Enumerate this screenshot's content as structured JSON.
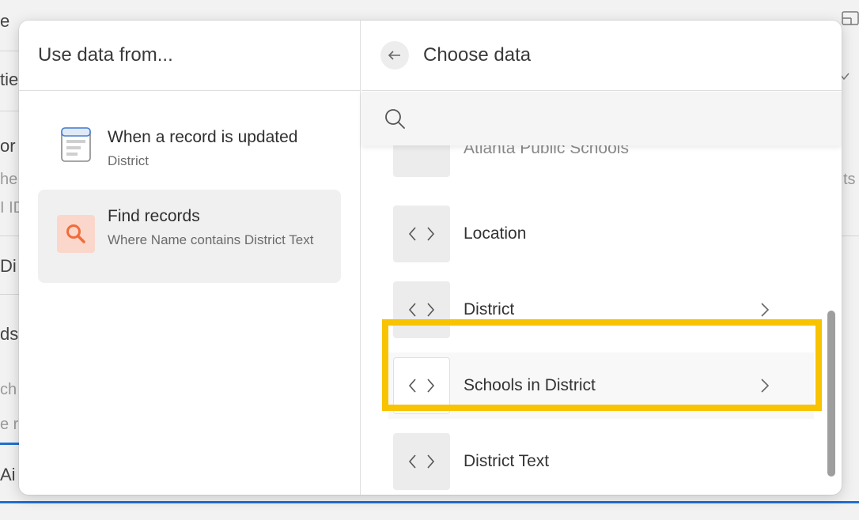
{
  "background": {
    "fragments": [
      "e",
      "tie",
      "or",
      "he",
      "I ID",
      "Di",
      "ds",
      "ch",
      "e r",
      "Ai",
      "ts"
    ]
  },
  "popup": {
    "left_pane": {
      "header": "Use data from...",
      "items": [
        {
          "title": "When a record is updated",
          "subtitle": "District",
          "icon": "record-form-icon"
        },
        {
          "title": "Find records",
          "subtitle": "Where Name contains District Text",
          "icon": "search-icon"
        }
      ]
    },
    "right_pane": {
      "header": "Choose data",
      "search": {
        "value": "",
        "placeholder": ""
      },
      "fields": [
        {
          "label": "Atlanta Public Schools",
          "icon": "code-brackets-icon",
          "has_children": false
        },
        {
          "label": "Location",
          "icon": "code-brackets-icon",
          "has_children": false
        },
        {
          "label": "District",
          "icon": "code-brackets-icon",
          "has_children": true
        },
        {
          "label": "Schools in District",
          "icon": "code-brackets-icon",
          "has_children": true
        },
        {
          "label": "District Text",
          "icon": "code-brackets-icon",
          "has_children": false
        }
      ]
    }
  },
  "colors": {
    "highlight": "#f8c300",
    "find_icon_bg": "#fbd7cb",
    "find_icon_fg": "#f26b3a",
    "bottom_accent": "#1f6fd1"
  }
}
